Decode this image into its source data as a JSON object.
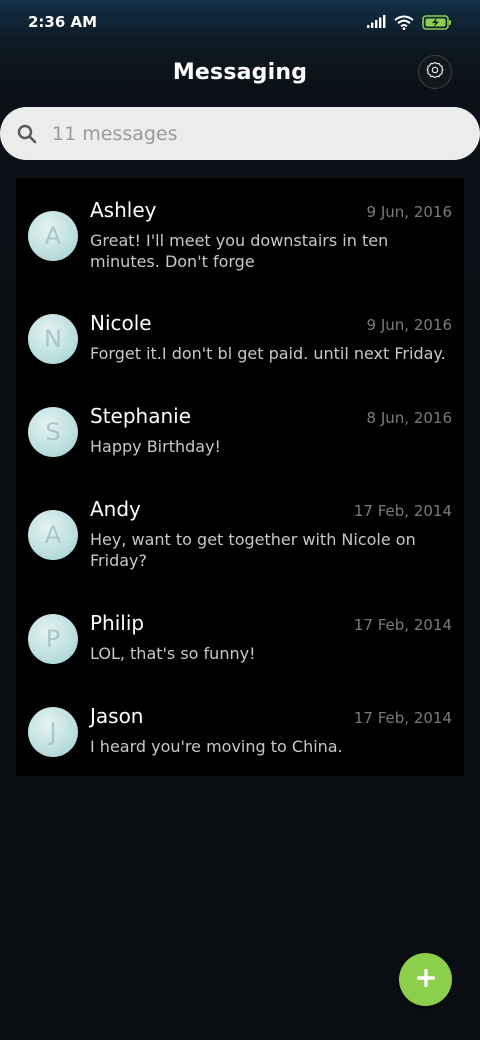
{
  "status_bar": {
    "time": "2:36 AM",
    "icons": [
      "signal-icon",
      "wifi-icon",
      "battery-charging-icon"
    ]
  },
  "header": {
    "title": "Messaging",
    "settings_icon": "gear-icon"
  },
  "search": {
    "placeholder": "11 messages",
    "icon": "search-icon"
  },
  "conversations": [
    {
      "initial": "A",
      "name": "Ashley",
      "date": "9 Jun, 2016",
      "preview": "Great! I'll meet you downstairs in ten minutes. Don't forge"
    },
    {
      "initial": "N",
      "name": "Nicole",
      "date": "9 Jun, 2016",
      "preview": "Forget it.I don't bl get paid. until next Friday."
    },
    {
      "initial": "S",
      "name": "Stephanie",
      "date": "8 Jun, 2016",
      "preview": "Happy Birthday!"
    },
    {
      "initial": "A",
      "name": "Andy",
      "date": "17 Feb, 2014",
      "preview": "Hey, want to get together with Nicole on Friday?"
    },
    {
      "initial": "P",
      "name": "Philip",
      "date": "17 Feb, 2014",
      "preview": "LOL, that's so funny!"
    },
    {
      "initial": "J",
      "name": "Jason",
      "date": "17 Feb, 2014",
      "preview": "I heard you're moving to China."
    }
  ],
  "fab": {
    "icon": "plus-icon"
  },
  "colors": {
    "accent": "#8ccf4d",
    "search_bg": "#ececec",
    "list_bg": "#000000",
    "date_text": "#777c80",
    "preview_text": "#c8c8c8"
  }
}
